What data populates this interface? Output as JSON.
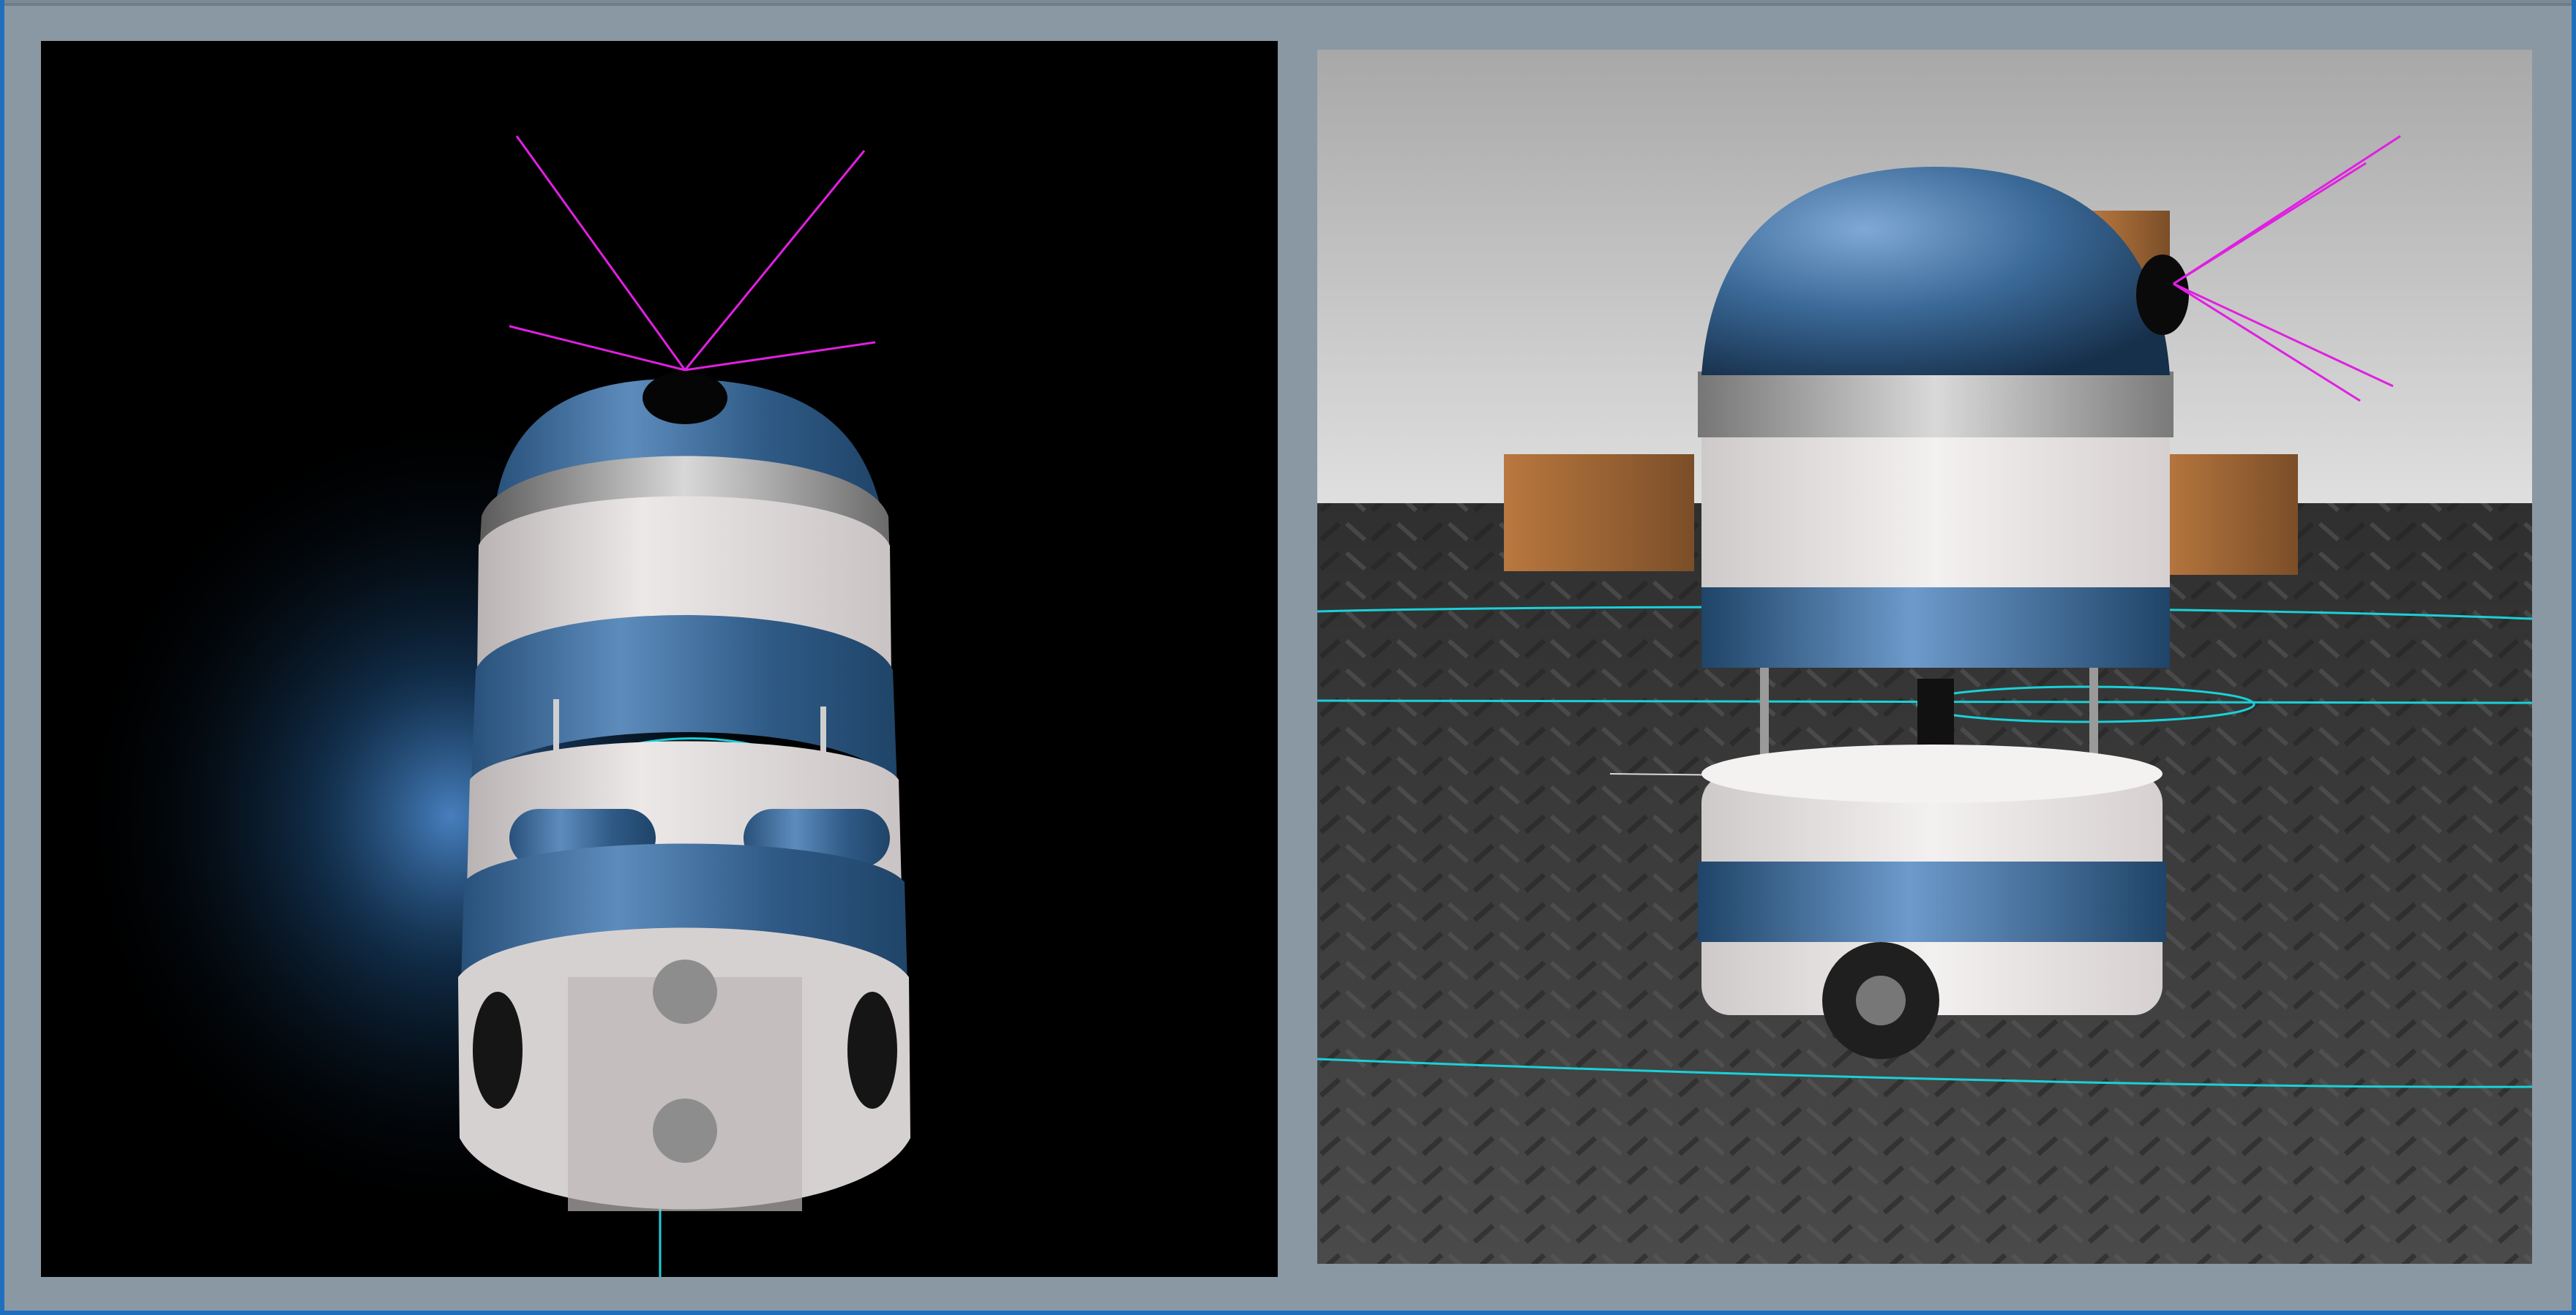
{
  "app": {
    "type": "robot-simulator-3d-viewports",
    "colors": {
      "frame": "#8a98a3",
      "window_border": "#1f6fbf",
      "sensor_ray": "#e020e0",
      "laser_scan": "#1ad0d8",
      "robot_blue": "#3e6a96",
      "robot_white": "#e6e2e2"
    }
  },
  "viewports": [
    {
      "id": "top-down-view",
      "background": "#000000"
    },
    {
      "id": "side-perspective-view",
      "background": "#3a3a3a"
    }
  ]
}
